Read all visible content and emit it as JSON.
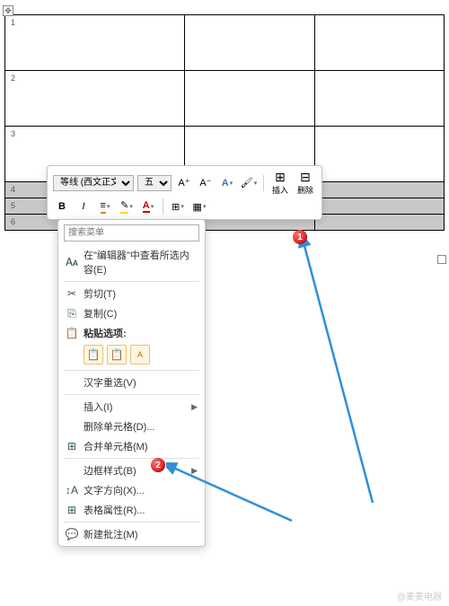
{
  "table": {
    "rows": [
      [
        "1",
        "",
        ""
      ],
      [
        "2",
        "",
        ""
      ],
      [
        "3",
        "",
        ""
      ]
    ],
    "selRows": [
      [
        "4",
        "",
        ""
      ],
      [
        "5",
        "",
        ""
      ],
      [
        "6",
        "",
        ""
      ]
    ]
  },
  "toolbar": {
    "font_name": "等线 (西文正文)",
    "font_size": "五号",
    "grow": "A⁺",
    "shrink": "A⁻",
    "style": "A",
    "bold": "B",
    "italic": "I",
    "insert": "插入",
    "delete": "删除"
  },
  "menu": {
    "search_ph": "搜索菜单",
    "lookup": "在\"编辑器\"中查看所选内容(E)",
    "cut": "剪切(T)",
    "copy": "复制(C)",
    "paste_opt": "粘贴选项:",
    "ime": "汉字重选(V)",
    "insert": "插入(I)",
    "delcell": "删除单元格(D)...",
    "merge": "合并单元格(M)",
    "border": "边框样式(B)",
    "textdir": "文字方向(X)...",
    "props": "表格属性(R)...",
    "comment": "新建批注(M)"
  },
  "callouts": {
    "c1": "1",
    "c2": "2"
  },
  "watermark": "@麦麦电器"
}
